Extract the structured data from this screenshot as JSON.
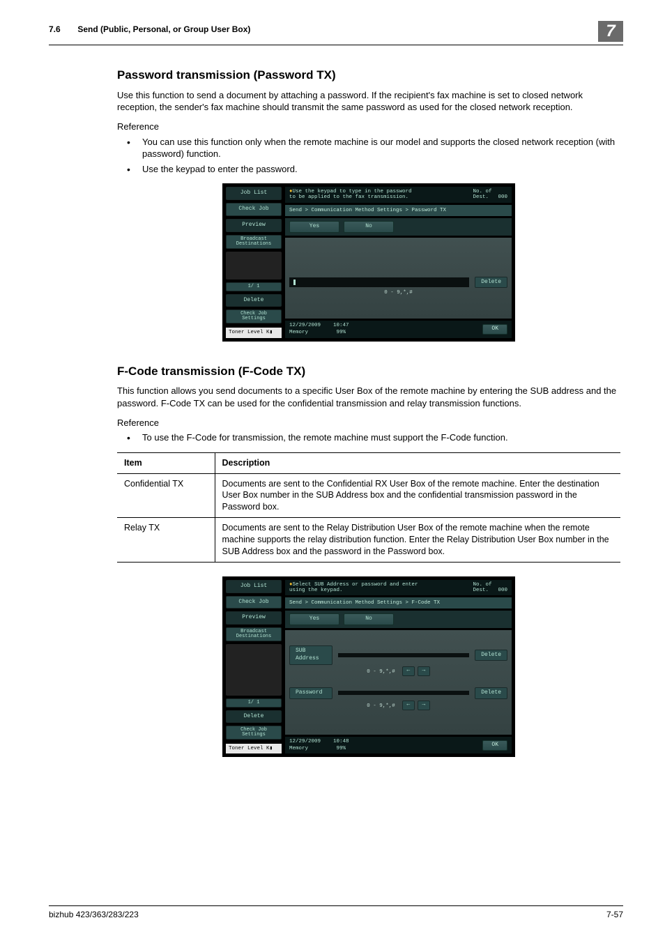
{
  "header": {
    "section_number": "7.6",
    "section_title": "Send (Public, Personal, or Group User Box)",
    "chapter_number": "7"
  },
  "section1": {
    "title": "Password transmission (Password TX)",
    "intro": "Use this function to send a document by attaching a password. If the recipient's fax machine is set to closed network reception, the sender's fax machine should transmit the same password as used for the closed network reception.",
    "reference_label": "Reference",
    "bullets": [
      "You can use this function only when the remote machine is our model and supports the closed network reception (with password) function.",
      "Use the keypad to enter the password."
    ]
  },
  "screenshot1": {
    "left": {
      "job_list": "Job List",
      "check_job": "Check Job",
      "preview": "Preview",
      "broadcast": "Broadcast\nDestinations",
      "page": "1/  1",
      "delete": "Delete",
      "check_settings": "Check Job\nSettings",
      "toner": "Toner Level  K"
    },
    "top_hint": "Use the keypad to type in the password\nto be applied to the fax transmission.",
    "no_of_dest": "No. of\nDest.",
    "no_of_dest_val": "000",
    "breadcrumb": "Send > Communication Method Settings > Password TX",
    "yes": "Yes",
    "no": "No",
    "input_hint": "0 - 9,*,#",
    "delete": "Delete",
    "bottom_date": "12/29/2009",
    "bottom_time": "10:47",
    "bottom_mem": "Memory",
    "bottom_mem_val": "99%",
    "ok": "OK"
  },
  "section2": {
    "title": "F-Code transmission (F-Code TX)",
    "intro": "This function allows you send documents to a specific User Box of the remote machine by entering the SUB address and the password. F-Code TX can be used for the confidential transmission and relay transmission functions.",
    "reference_label": "Reference",
    "bullets": [
      "To use the F-Code for transmission, the remote machine must support the F-Code function."
    ],
    "table": {
      "headers": [
        "Item",
        "Description"
      ],
      "rows": [
        {
          "item": "Confidential TX",
          "desc": "Documents are sent to the Confidential RX User Box of the remote machine. Enter the destination User Box number in the SUB Address box and the confidential transmission password in the Password box."
        },
        {
          "item": "Relay TX",
          "desc": "Documents are sent to the Relay Distribution User Box of the remote machine when the remote machine supports the relay distribution function. Enter the Relay Distribution User Box number in the SUB Address box and the password in the Password box."
        }
      ]
    }
  },
  "screenshot2": {
    "top_hint": "Select SUB Address or password and enter\nusing the keypad.",
    "breadcrumb": "Send > Communication Method Settings > F-Code TX",
    "sub_address": "SUB Address",
    "password": "Password",
    "input_hint": "0 - 9,*,#",
    "delete": "Delete",
    "bottom_time": "10:48"
  },
  "footer": {
    "model": "bizhub 423/363/283/223",
    "page": "7-57"
  }
}
